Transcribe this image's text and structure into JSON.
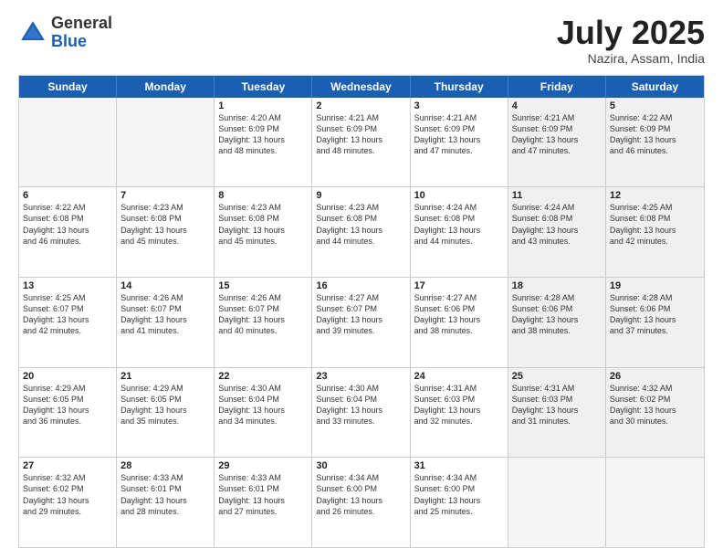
{
  "logo": {
    "general": "General",
    "blue": "Blue"
  },
  "header": {
    "month": "July 2025",
    "location": "Nazira, Assam, India"
  },
  "weekdays": [
    "Sunday",
    "Monday",
    "Tuesday",
    "Wednesday",
    "Thursday",
    "Friday",
    "Saturday"
  ],
  "rows": [
    [
      {
        "day": "",
        "empty": true
      },
      {
        "day": "",
        "empty": true
      },
      {
        "day": "1",
        "line1": "Sunrise: 4:20 AM",
        "line2": "Sunset: 6:09 PM",
        "line3": "Daylight: 13 hours",
        "line4": "and 48 minutes."
      },
      {
        "day": "2",
        "line1": "Sunrise: 4:21 AM",
        "line2": "Sunset: 6:09 PM",
        "line3": "Daylight: 13 hours",
        "line4": "and 48 minutes."
      },
      {
        "day": "3",
        "line1": "Sunrise: 4:21 AM",
        "line2": "Sunset: 6:09 PM",
        "line3": "Daylight: 13 hours",
        "line4": "and 47 minutes."
      },
      {
        "day": "4",
        "line1": "Sunrise: 4:21 AM",
        "line2": "Sunset: 6:09 PM",
        "line3": "Daylight: 13 hours",
        "line4": "and 47 minutes."
      },
      {
        "day": "5",
        "line1": "Sunrise: 4:22 AM",
        "line2": "Sunset: 6:09 PM",
        "line3": "Daylight: 13 hours",
        "line4": "and 46 minutes."
      }
    ],
    [
      {
        "day": "6",
        "line1": "Sunrise: 4:22 AM",
        "line2": "Sunset: 6:08 PM",
        "line3": "Daylight: 13 hours",
        "line4": "and 46 minutes."
      },
      {
        "day": "7",
        "line1": "Sunrise: 4:23 AM",
        "line2": "Sunset: 6:08 PM",
        "line3": "Daylight: 13 hours",
        "line4": "and 45 minutes."
      },
      {
        "day": "8",
        "line1": "Sunrise: 4:23 AM",
        "line2": "Sunset: 6:08 PM",
        "line3": "Daylight: 13 hours",
        "line4": "and 45 minutes."
      },
      {
        "day": "9",
        "line1": "Sunrise: 4:23 AM",
        "line2": "Sunset: 6:08 PM",
        "line3": "Daylight: 13 hours",
        "line4": "and 44 minutes."
      },
      {
        "day": "10",
        "line1": "Sunrise: 4:24 AM",
        "line2": "Sunset: 6:08 PM",
        "line3": "Daylight: 13 hours",
        "line4": "and 44 minutes."
      },
      {
        "day": "11",
        "line1": "Sunrise: 4:24 AM",
        "line2": "Sunset: 6:08 PM",
        "line3": "Daylight: 13 hours",
        "line4": "and 43 minutes."
      },
      {
        "day": "12",
        "line1": "Sunrise: 4:25 AM",
        "line2": "Sunset: 6:08 PM",
        "line3": "Daylight: 13 hours",
        "line4": "and 42 minutes."
      }
    ],
    [
      {
        "day": "13",
        "line1": "Sunrise: 4:25 AM",
        "line2": "Sunset: 6:07 PM",
        "line3": "Daylight: 13 hours",
        "line4": "and 42 minutes."
      },
      {
        "day": "14",
        "line1": "Sunrise: 4:26 AM",
        "line2": "Sunset: 6:07 PM",
        "line3": "Daylight: 13 hours",
        "line4": "and 41 minutes."
      },
      {
        "day": "15",
        "line1": "Sunrise: 4:26 AM",
        "line2": "Sunset: 6:07 PM",
        "line3": "Daylight: 13 hours",
        "line4": "and 40 minutes."
      },
      {
        "day": "16",
        "line1": "Sunrise: 4:27 AM",
        "line2": "Sunset: 6:07 PM",
        "line3": "Daylight: 13 hours",
        "line4": "and 39 minutes."
      },
      {
        "day": "17",
        "line1": "Sunrise: 4:27 AM",
        "line2": "Sunset: 6:06 PM",
        "line3": "Daylight: 13 hours",
        "line4": "and 38 minutes."
      },
      {
        "day": "18",
        "line1": "Sunrise: 4:28 AM",
        "line2": "Sunset: 6:06 PM",
        "line3": "Daylight: 13 hours",
        "line4": "and 38 minutes."
      },
      {
        "day": "19",
        "line1": "Sunrise: 4:28 AM",
        "line2": "Sunset: 6:06 PM",
        "line3": "Daylight: 13 hours",
        "line4": "and 37 minutes."
      }
    ],
    [
      {
        "day": "20",
        "line1": "Sunrise: 4:29 AM",
        "line2": "Sunset: 6:05 PM",
        "line3": "Daylight: 13 hours",
        "line4": "and 36 minutes."
      },
      {
        "day": "21",
        "line1": "Sunrise: 4:29 AM",
        "line2": "Sunset: 6:05 PM",
        "line3": "Daylight: 13 hours",
        "line4": "and 35 minutes."
      },
      {
        "day": "22",
        "line1": "Sunrise: 4:30 AM",
        "line2": "Sunset: 6:04 PM",
        "line3": "Daylight: 13 hours",
        "line4": "and 34 minutes."
      },
      {
        "day": "23",
        "line1": "Sunrise: 4:30 AM",
        "line2": "Sunset: 6:04 PM",
        "line3": "Daylight: 13 hours",
        "line4": "and 33 minutes."
      },
      {
        "day": "24",
        "line1": "Sunrise: 4:31 AM",
        "line2": "Sunset: 6:03 PM",
        "line3": "Daylight: 13 hours",
        "line4": "and 32 minutes."
      },
      {
        "day": "25",
        "line1": "Sunrise: 4:31 AM",
        "line2": "Sunset: 6:03 PM",
        "line3": "Daylight: 13 hours",
        "line4": "and 31 minutes."
      },
      {
        "day": "26",
        "line1": "Sunrise: 4:32 AM",
        "line2": "Sunset: 6:02 PM",
        "line3": "Daylight: 13 hours",
        "line4": "and 30 minutes."
      }
    ],
    [
      {
        "day": "27",
        "line1": "Sunrise: 4:32 AM",
        "line2": "Sunset: 6:02 PM",
        "line3": "Daylight: 13 hours",
        "line4": "and 29 minutes."
      },
      {
        "day": "28",
        "line1": "Sunrise: 4:33 AM",
        "line2": "Sunset: 6:01 PM",
        "line3": "Daylight: 13 hours",
        "line4": "and 28 minutes."
      },
      {
        "day": "29",
        "line1": "Sunrise: 4:33 AM",
        "line2": "Sunset: 6:01 PM",
        "line3": "Daylight: 13 hours",
        "line4": "and 27 minutes."
      },
      {
        "day": "30",
        "line1": "Sunrise: 4:34 AM",
        "line2": "Sunset: 6:00 PM",
        "line3": "Daylight: 13 hours",
        "line4": "and 26 minutes."
      },
      {
        "day": "31",
        "line1": "Sunrise: 4:34 AM",
        "line2": "Sunset: 6:00 PM",
        "line3": "Daylight: 13 hours",
        "line4": "and 25 minutes."
      },
      {
        "day": "",
        "empty": true
      },
      {
        "day": "",
        "empty": true
      }
    ]
  ]
}
